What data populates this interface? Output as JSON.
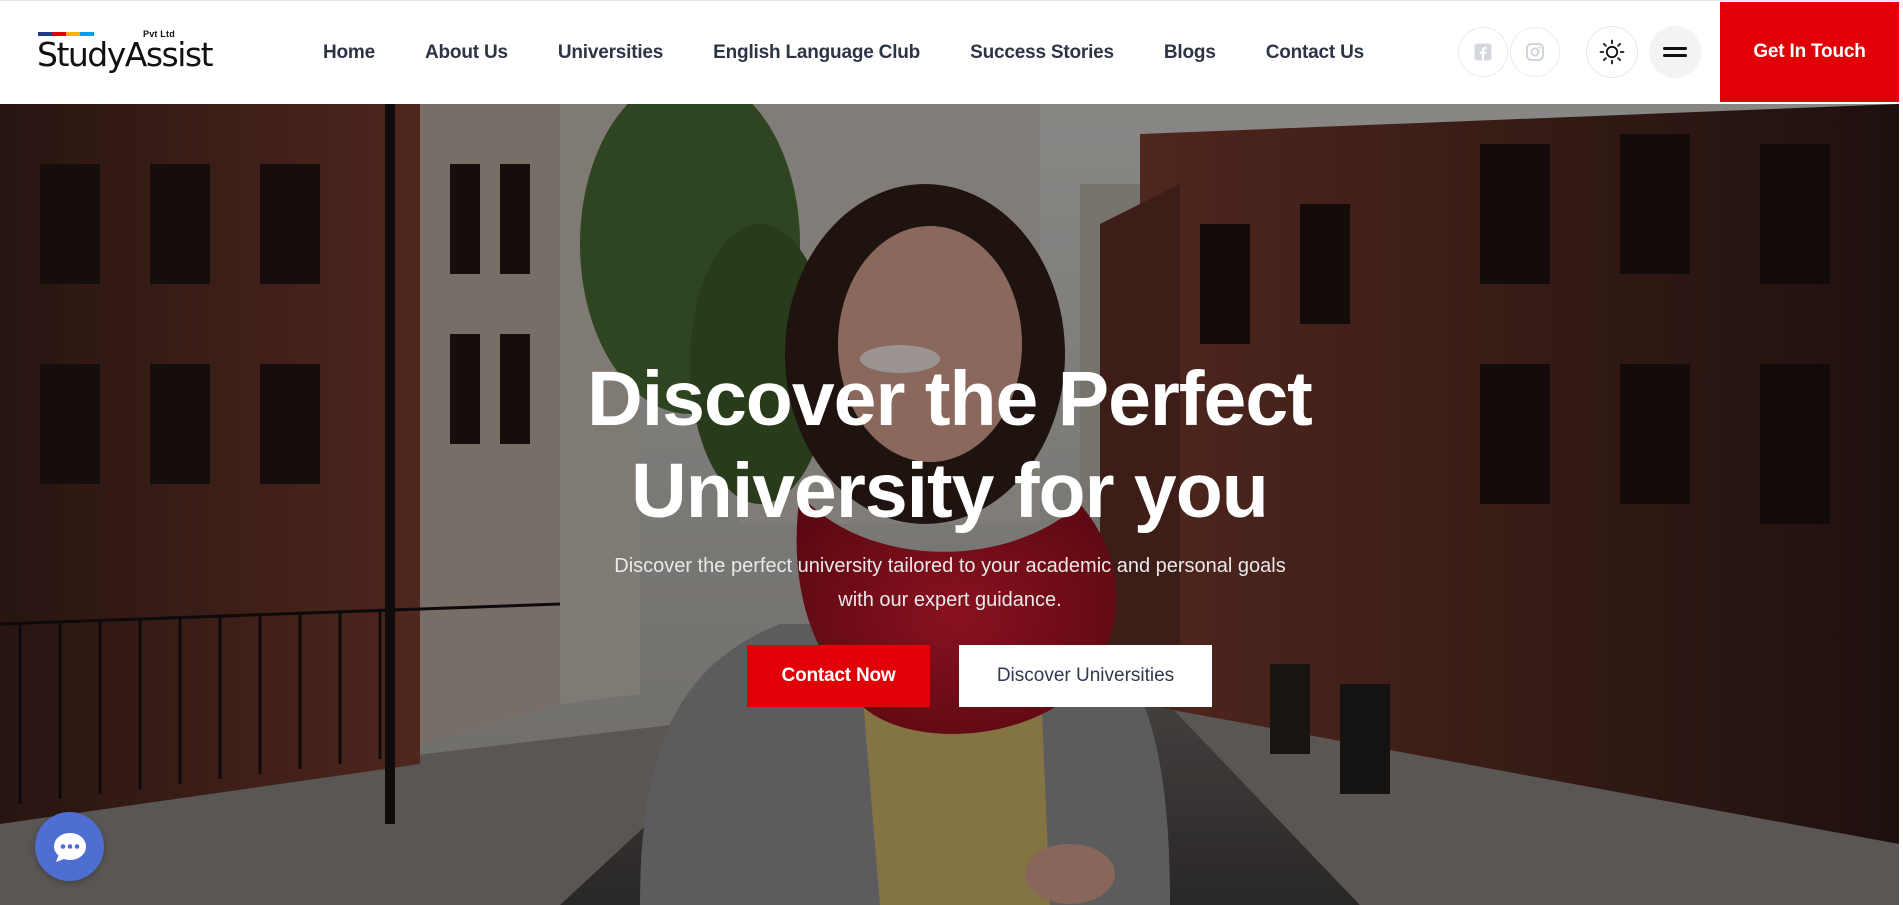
{
  "brand": {
    "name": "StudyAssist",
    "suffix": "Pvt Ltd",
    "bar_colors": [
      "#1e3a8a",
      "#e10007",
      "#f4b400",
      "#00a0e9"
    ]
  },
  "nav": {
    "items": [
      {
        "label": "Home"
      },
      {
        "label": "About Us"
      },
      {
        "label": "Universities"
      },
      {
        "label": "English Language Club"
      },
      {
        "label": "Success Stories"
      },
      {
        "label": "Blogs"
      },
      {
        "label": "Contact Us"
      }
    ]
  },
  "header_actions": {
    "social_icons": [
      "facebook-icon",
      "instagram-icon"
    ],
    "theme_icon": "sun-icon",
    "menu_icon": "menu-icon",
    "cta_label": "Get In Touch"
  },
  "hero": {
    "title_line1": "Discover the Perfect",
    "title_line2": "University for you",
    "subtitle_line1": "Discover the perfect university tailored to your academic and personal goals",
    "subtitle_line2": "with our expert guidance.",
    "primary_button": "Contact Now",
    "secondary_button": "Discover Universities",
    "background_description_icon": "photo-woman-red-scarf-street"
  },
  "chat_widget": {
    "icon": "chat-bubble-icon"
  },
  "colors": {
    "accent": "#e10007",
    "nav_text": "#2d3545",
    "chat": "#4f6ed1",
    "white": "#ffffff"
  }
}
